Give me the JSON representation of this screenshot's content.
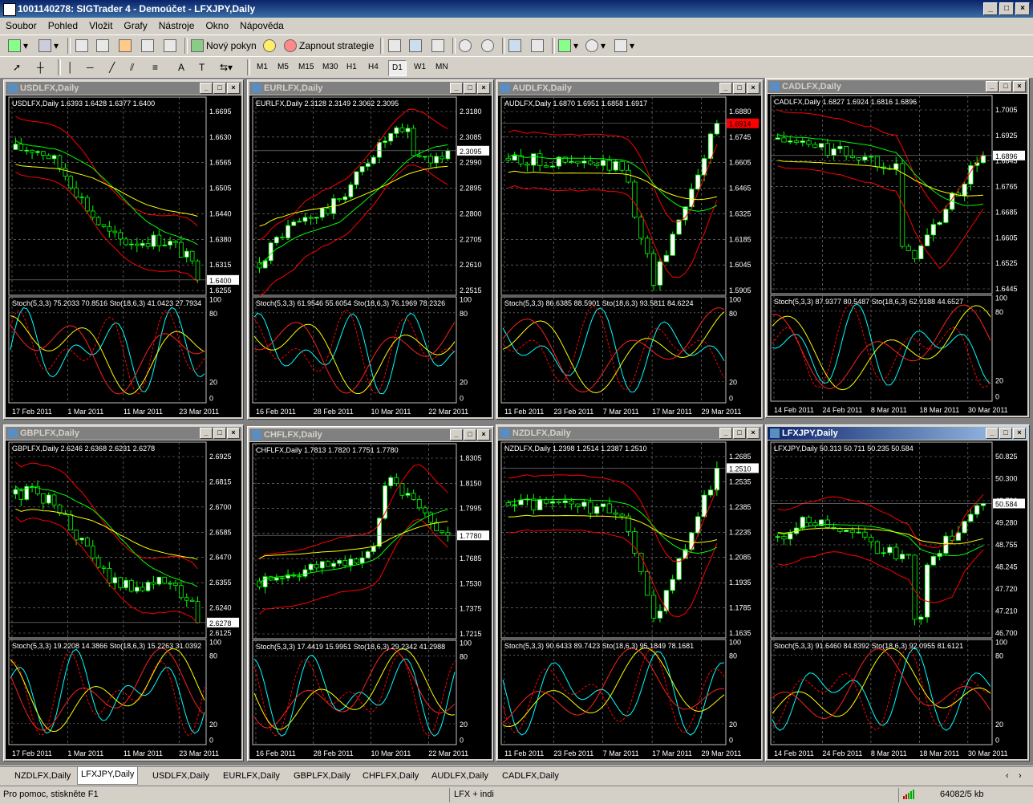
{
  "app": {
    "title": "1001140278: SIGTrader 4 - Demoúčet - LFXJPY,Daily"
  },
  "menu": [
    "Soubor",
    "Pohled",
    "Vložit",
    "Grafy",
    "Nástroje",
    "Okno",
    "Nápověda"
  ],
  "toolbar": {
    "new_order": "Nový pokyn",
    "strategy": "Zapnout strategie"
  },
  "timeframes": [
    "M1",
    "M5",
    "M15",
    "M30",
    "H1",
    "H4",
    "D1",
    "W1",
    "MN"
  ],
  "active_timeframe": "D1",
  "tabs": [
    "NZDLFX,Daily",
    "LFXJPY,Daily",
    "USDLFX,Daily",
    "EURLFX,Daily",
    "GBPLFX,Daily",
    "CHFLFX,Daily",
    "AUDLFX,Daily",
    "CADLFX,Daily"
  ],
  "active_tab": "LFXJPY,Daily",
  "status": {
    "help": "Pro pomoc, stiskněte F1",
    "profile": "LFX + indi",
    "traffic": "64082/5 kb"
  },
  "colors": {
    "up": "#ffffff",
    "down": "#000000",
    "candle_border": "#00ff00",
    "bb": "#ff0000",
    "ma_fast": "#00ff00",
    "ma_slow": "#ffff00",
    "stoch_main": "#00ffff",
    "stoch_signal": "#ff0000",
    "bg": "#000000",
    "grid": "#888888"
  },
  "charts": [
    {
      "id": "usdlfx",
      "title": "USDLFX,Daily",
      "header": "USDLFX,Daily  1.6393 1.6428 1.6377 1.6400",
      "prices": [
        "1.6695",
        "1.6630",
        "1.6565",
        "1.6505",
        "1.6440",
        "1.6380",
        "1.6315",
        "1.6255"
      ],
      "last": "1.6400",
      "stoch": "Stoch(5,3,3) 75.2033 70.8516   Sto(18,6,3) 41.0423 27.7934",
      "dates": [
        "17 Feb 2011",
        "1 Mar 2011",
        "11 Mar 2011",
        "23 Mar 2011"
      ],
      "trend": "down",
      "active": false
    },
    {
      "id": "eurlfx",
      "title": "EURLFX,Daily",
      "header": "EURLFX,Daily  2.3128 2.3149 2.3062 2.3095",
      "prices": [
        "2.3180",
        "2.3085",
        "2.2990",
        "2.2895",
        "2.2800",
        "2.2705",
        "2.2610",
        "2.2515"
      ],
      "last": "2.3095",
      "stoch": "Stoch(5,3,3) 61.9546 55.6054   Sto(18,6,3) 76.1969 78.2326",
      "dates": [
        "16 Feb 2011",
        "28 Feb 2011",
        "10 Mar 2011",
        "22 Mar 2011"
      ],
      "trend": "up",
      "active": false
    },
    {
      "id": "audlfx",
      "title": "AUDLFX,Daily",
      "header": "AUDLFX,Daily  1.6870 1.6951 1.6858 1.6917",
      "prices": [
        "1.6880",
        "1.6745",
        "1.6605",
        "1.6465",
        "1.6325",
        "1.6185",
        "1.6045",
        "1.5905"
      ],
      "last": "1.6914",
      "stoch": "Stoch(5,3,3) 86.6385 88.5901   Sto(18,6,3) 93.5811 84.6224",
      "dates": [
        "11 Feb 2011",
        "23 Feb 2011",
        "7 Mar 2011",
        "17 Mar 2011",
        "29 Mar 2011"
      ],
      "trend": "vshape",
      "active": false
    },
    {
      "id": "cadlfx",
      "title": "CADLFX,Daily",
      "header": "CADLFX,Daily  1.6827 1.6924 1.6816 1.6896",
      "prices": [
        "1.7005",
        "1.6925",
        "1.6845",
        "1.6765",
        "1.6685",
        "1.6605",
        "1.6525",
        "1.6445"
      ],
      "last": "1.6896",
      "stoch": "Stoch(5,3,3) 87.9377 80.5487   Sto(18,6,3) 62.9188 44.6527",
      "dates": [
        "14 Feb 2011",
        "24 Feb 2011",
        "8 Mar 2011",
        "18 Mar 2011",
        "30 Mar 2011"
      ],
      "trend": "dip",
      "active": false
    },
    {
      "id": "gbplfx",
      "title": "GBPLFX,Daily",
      "header": "GBPLFX,Daily  2.6246 2.6368 2.6231 2.6278",
      "prices": [
        "2.6925",
        "2.6815",
        "2.6700",
        "2.6585",
        "2.6470",
        "2.6355",
        "2.6240",
        "2.6125"
      ],
      "last": "2.6278",
      "stoch": "Stoch(5,3,3) 19.2208 14.3866   Sto(18,6,3) 15.2263 31.0392",
      "dates": [
        "17 Feb 2011",
        "1 Mar 2011",
        "11 Mar 2011",
        "23 Mar 2011"
      ],
      "trend": "down",
      "active": false
    },
    {
      "id": "chflfx",
      "title": "CHFLFX,Daily",
      "header": "CHFLFX,Daily  1.7813 1.7820 1.7751 1.7780",
      "prices": [
        "1.8305",
        "1.8150",
        "1.7995",
        "1.7840",
        "1.7685",
        "1.7530",
        "1.7375",
        "1.7215"
      ],
      "last": "1.7780",
      "stoch": "Stoch(5,3,3) 17.4419 15.9951   Sto(18,6,3) 29.2342 41.2988",
      "dates": [
        "16 Feb 2011",
        "28 Feb 2011",
        "10 Mar 2011",
        "22 Mar 2011"
      ],
      "trend": "spike",
      "active": false
    },
    {
      "id": "nzdlfx",
      "title": "NZDLFX,Daily",
      "header": "NZDLFX,Daily  1.2398 1.2514 1.2387 1.2510",
      "prices": [
        "1.2685",
        "1.2535",
        "1.2385",
        "1.2235",
        "1.2085",
        "1.1935",
        "1.1785",
        "1.1635"
      ],
      "last": "1.2510",
      "stoch": "Stoch(5,3,3) 90.6433 89.7423   Sto(18,6,3) 95.1849 78.1681",
      "dates": [
        "11 Feb 2011",
        "23 Feb 2011",
        "7 Mar 2011",
        "17 Mar 2011",
        "29 Mar 2011"
      ],
      "trend": "vshape",
      "active": false
    },
    {
      "id": "lfxjpy",
      "title": "LFXJPY,Daily",
      "header": "LFXJPY,Daily  50.313 50.711 50.235 50.584",
      "prices": [
        "50.825",
        "50.300",
        "49.790",
        "49.280",
        "48.755",
        "48.245",
        "47.720",
        "47.210",
        "46.700"
      ],
      "last": "50.584",
      "stoch": "Stoch(5,3,3) 91.6460 84.8392   Sto(18,6,3) 92.0955 81.6121",
      "dates": [
        "14 Feb 2011",
        "24 Feb 2011",
        "8 Mar 2011",
        "18 Mar 2011",
        "30 Mar 2011"
      ],
      "trend": "crash",
      "active": true
    }
  ],
  "stoch_levels": [
    "100",
    "80",
    "20",
    "0"
  ]
}
